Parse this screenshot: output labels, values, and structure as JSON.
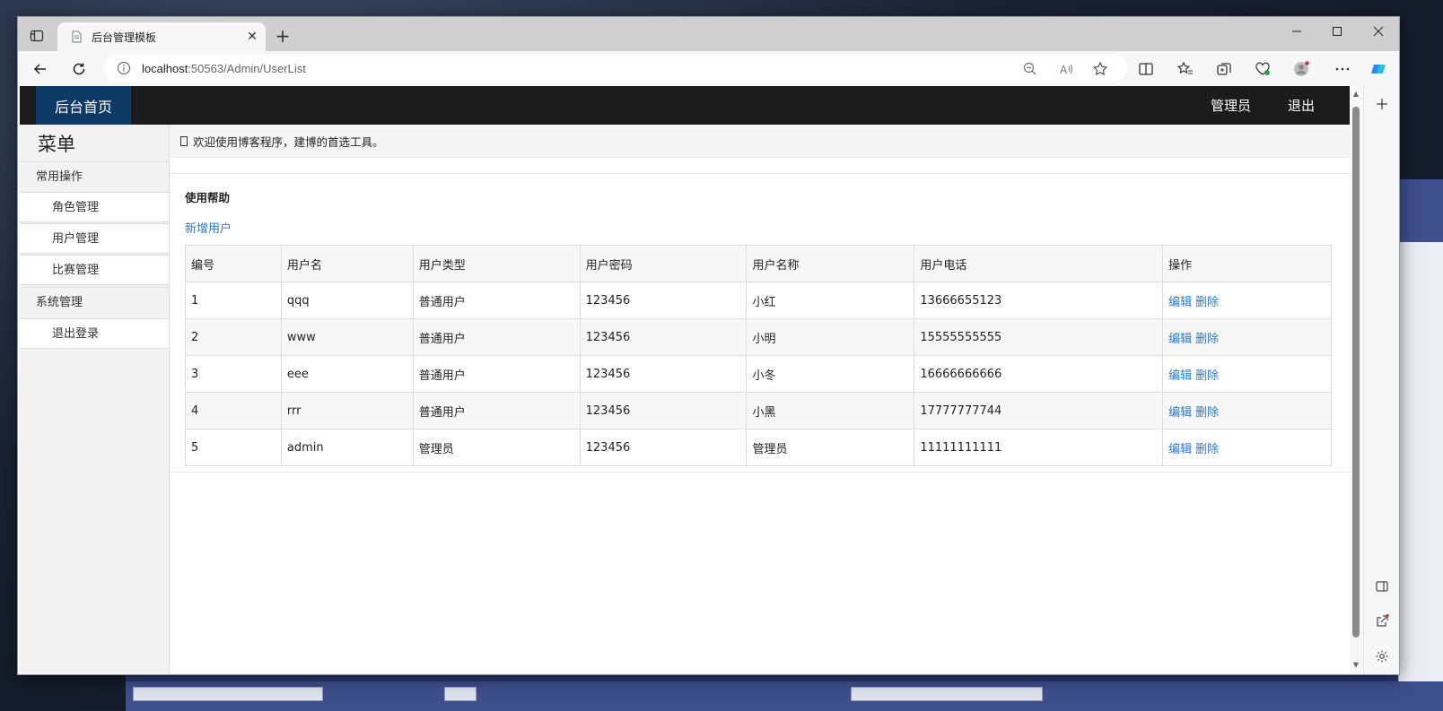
{
  "browser": {
    "tab_title": "后台管理模板",
    "url_host": "localhost",
    "url_rest": ":50563/Admin/UserList",
    "new_tab_label": "+",
    "close_tab_label": "✕"
  },
  "site": {
    "brand": "后台首页",
    "nav_admin": "管理员",
    "nav_logout": "退出"
  },
  "sidebar": {
    "title": "菜单",
    "groups": [
      {
        "label": "常用操作",
        "items": [
          "角色管理",
          "用户管理",
          "比赛管理"
        ]
      },
      {
        "label": "系统管理",
        "items": [
          "退出登录"
        ]
      }
    ]
  },
  "main": {
    "welcome": "欢迎使用博客程序，建博的首选工具。",
    "help_title": "使用帮助",
    "add_user": "新增用户"
  },
  "table": {
    "columns": [
      "编号",
      "用户名",
      "用户类型",
      "用户密码",
      "用户名称",
      "用户电话",
      "操作"
    ],
    "rows": [
      [
        "1",
        "qqq",
        "普通用户",
        "123456",
        "小红",
        "13666655123"
      ],
      [
        "2",
        "www",
        "普通用户",
        "123456",
        "小明",
        "15555555555"
      ],
      [
        "3",
        "eee",
        "普通用户",
        "123456",
        "小冬",
        "16666666666"
      ],
      [
        "4",
        "rrr",
        "普通用户",
        "123456",
        "小黑",
        "17777777744"
      ],
      [
        "5",
        "admin",
        "管理员",
        "123456",
        "管理员",
        "11111111111"
      ]
    ],
    "edit_label": "编辑",
    "delete_label": "删除"
  },
  "colors": {
    "navbar": "#1b1b1b",
    "brand_bg": "#0f3a66",
    "link": "#2a7bc4"
  }
}
